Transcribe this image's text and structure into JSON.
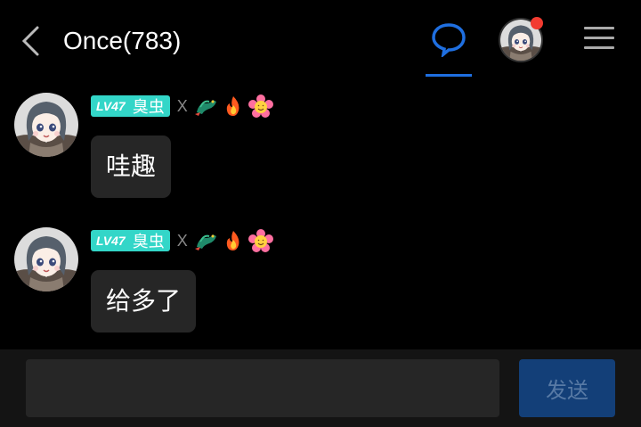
{
  "header": {
    "title": "Once(783)",
    "back_icon": "chevron-left-icon",
    "chat_icon": "chat-bubble-icon",
    "menu_icon": "hamburger-menu-icon",
    "accent": "#1f6fe0",
    "notification_dot_color": "#f23b30"
  },
  "messages": [
    {
      "level": "LV47",
      "nickname": "臭虫",
      "separator": "X",
      "emojis": [
        "dragon-icon",
        "fire-icon",
        "flower-face-icon"
      ],
      "text": "哇趣"
    },
    {
      "level": "LV47",
      "nickname": "臭虫",
      "separator": "X",
      "emojis": [
        "dragon-icon",
        "fire-icon",
        "flower-face-icon"
      ],
      "text": "给多了"
    }
  ],
  "input": {
    "value": "",
    "placeholder": ""
  },
  "send_label": "发送",
  "colors": {
    "level_badge": "#33d6c8",
    "send_button": "#133f78",
    "bubble": "#262626"
  }
}
